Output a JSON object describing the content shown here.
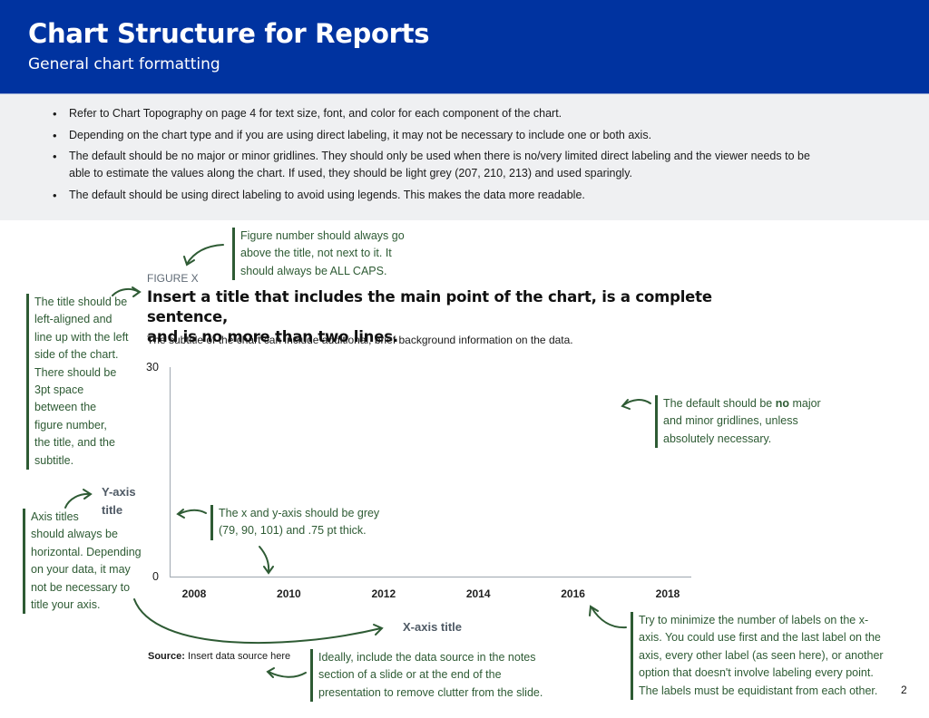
{
  "header": {
    "title": "Chart Structure for Reports",
    "subtitle": "General chart formatting"
  },
  "guidelines": [
    "Refer to Chart Topography on page 4 for text size, font, and color for each component of the chart.",
    "Depending on the chart type and if you are using direct labeling, it may not be necessary to include one or both axis.",
    "The default should be no major or minor gridlines. They should only be used when there is no/very limited direct labeling and the viewer needs to be",
    "able to estimate the values along the chart. If used, they should be light grey (207, 210, 213) and used sparingly.",
    "The default should be using direct labeling to avoid using legends. This makes the data more readable."
  ],
  "figure": {
    "number": "FIGURE X",
    "title_line1": "Insert a title that includes the main point of the chart, is a complete sentence,",
    "title_line2": "and is no more than two lines.",
    "subtitle": "The subtitle of the chart can include additional, brief background information on the data.",
    "source_label": "Source:",
    "source_text": " Insert data source here"
  },
  "chart_data": {
    "type": "line",
    "title": "Insert a title that includes the main point of the chart, is a complete sentence, and is no more than two lines.",
    "subtitle": "The subtitle of the chart can include additional, brief background information on the data.",
    "xlabel": "X-axis title",
    "ylabel": "Y-axis title",
    "x_ticks": [
      "2008",
      "2010",
      "2012",
      "2014",
      "2016",
      "2018"
    ],
    "y_ticks": [
      "0",
      "30"
    ],
    "ylim": [
      0,
      30
    ],
    "xlim": [
      2008,
      2018
    ],
    "series": [],
    "grid": false,
    "axis_color": "#4f5a65"
  },
  "annotations": {
    "figure_number": [
      "Figure number should always go",
      "above the title, not next to it. It",
      "should always be ALL CAPS."
    ],
    "title_alignment": [
      "The title should be",
      "left-aligned and",
      "line up with the left",
      "side of the chart.",
      "There should be",
      "3pt space",
      "between the",
      "figure number,",
      "the title, and the",
      "subtitle."
    ],
    "gridlines_pre": "The default should be ",
    "gridlines_bold": "no",
    "gridlines_post": " major",
    "gridlines_rest": [
      "and minor gridlines, unless",
      "absolutely necessary."
    ],
    "axis_color": [
      "The x and y-axis should be grey",
      "(79, 90, 101) and .75 pt thick."
    ],
    "axis_titles": [
      "Axis titles",
      "should always be",
      "horizontal. Depending",
      "on your data, it may",
      "not be necessary to",
      "title your axis."
    ],
    "x_labels": [
      "Try to minimize the number of labels on the x-",
      "axis. You could use first and the last label on the",
      "axis, every other label (as seen here), or another",
      "option that doesn't involve labeling every point.",
      "The labels must be equidistant from each other."
    ],
    "source": [
      "Ideally, include the data source in the notes",
      "section of a slide or at the end of the",
      "presentation to remove clutter from the slide."
    ]
  },
  "colors": {
    "header_bg": "#0033a0",
    "guide_bg": "#eff0f2",
    "annotation_green": "#2e5b34",
    "axis_grey": "#4f5a65"
  },
  "page_number": "2"
}
